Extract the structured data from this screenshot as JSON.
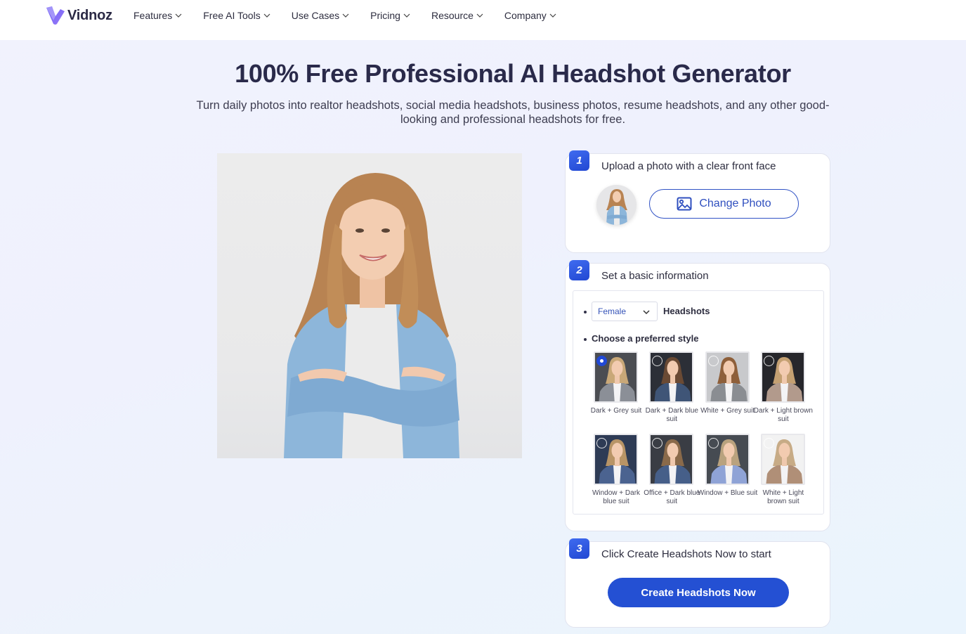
{
  "nav": {
    "brand": "Vidnoz",
    "items": [
      {
        "label": "Features"
      },
      {
        "label": "Free AI Tools"
      },
      {
        "label": "Use Cases"
      },
      {
        "label": "Pricing"
      },
      {
        "label": "Resource"
      },
      {
        "label": "Company"
      }
    ]
  },
  "hero": {
    "title": "100% Free Professional AI Headshot Generator",
    "subtitle": "Turn daily photos into realtor headshots, social media headshots, business photos, resume headshots, and any other good-looking and professional headshots for free."
  },
  "main_photo": {
    "description": "Smiling woman with wavy hair wearing denim jacket, arms crossed"
  },
  "steps": [
    {
      "number": "1",
      "title": "Upload a photo with a clear front face",
      "button": "Change Photo",
      "icon": "image-icon"
    },
    {
      "number": "2",
      "title": "Set a basic information",
      "gender_select": {
        "value": "Female"
      },
      "headshots_label": "Headshots",
      "style_label": "Choose a preferred style",
      "styles": [
        {
          "label": "Dark + Grey suit",
          "selected": true,
          "bg": "#4b4d52",
          "suit": "#8b8f97",
          "hair": "#c9a878"
        },
        {
          "label": "Dark + Dark blue suit",
          "selected": false,
          "bg": "#2c2f37",
          "suit": "#3f5577",
          "hair": "#6a4a34"
        },
        {
          "label": "White + Grey suit",
          "selected": false,
          "bg": "#c8c9cc",
          "suit": "#8a8d92",
          "hair": "#8e5f3a"
        },
        {
          "label": "Dark + Light brown suit",
          "selected": false,
          "bg": "#26262b",
          "suit": "#b29a8c",
          "hair": "#c4a072"
        },
        {
          "label": "Window + Dark blue suit",
          "selected": false,
          "bg": "#2e3b55",
          "suit": "#4b6390",
          "hair": "#b89466"
        },
        {
          "label": "Office + Dark blue suit",
          "selected": false,
          "bg": "#3a3d44",
          "suit": "#465f89",
          "hair": "#8a6a4a"
        },
        {
          "label": "Window + Blue suit",
          "selected": false,
          "bg": "#464b52",
          "suit": "#8fa3d6",
          "hair": "#b9a27e"
        },
        {
          "label": "White + Light brown suit",
          "selected": false,
          "bg": "#f2f2f2",
          "suit": "#b08f77",
          "hair": "#c7ab86"
        }
      ]
    },
    {
      "number": "3",
      "title": "Click Create Headshots Now to start",
      "button": "Create Headshots Now"
    }
  ],
  "colors": {
    "accent": "#2450d3",
    "title": "#2a2a4a",
    "outline_button": "#3153c5"
  }
}
